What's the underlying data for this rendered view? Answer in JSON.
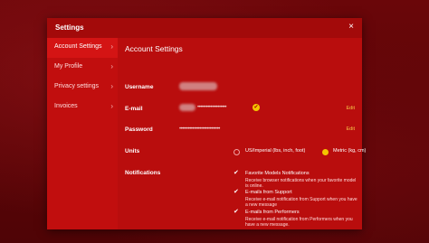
{
  "modal": {
    "title": "Settings",
    "close_label": "×"
  },
  "sidebar": {
    "items": [
      {
        "label": "Account Settings"
      },
      {
        "label": "My Profile"
      },
      {
        "label": "Privacy settings"
      },
      {
        "label": "Invoices"
      }
    ],
    "chevron": "›"
  },
  "content": {
    "title": "Account Settings",
    "username": {
      "label": "Username"
    },
    "email": {
      "label": "E-mail",
      "masked": "••••••••••••••••••••",
      "edit": "Edit"
    },
    "password": {
      "label": "Password",
      "masked": "••••••••••••••••••••••••••••",
      "edit": "Edit"
    },
    "units": {
      "label": "Units",
      "options": [
        {
          "label": "US/Imperial (lbs, inch, foot)",
          "checked": false
        },
        {
          "label": "Metric (kg, cm)",
          "checked": true
        }
      ]
    },
    "notifications": {
      "label": "Notifications",
      "items": [
        {
          "title": "Favorite Models Notifications",
          "desc": "Receive browser notifications when your favorite model is online.",
          "checked": true
        },
        {
          "title": "E-mails from Support",
          "desc": "Receive e-mail notification from Support when you have a new message",
          "checked": true
        },
        {
          "title": "E-mails from Performers",
          "desc": "Receive e-mail notification from Performers when you have a new message.",
          "checked": true
        }
      ],
      "check_glyph": "✔"
    }
  },
  "colors": {
    "modal_bg": "#b90d0d",
    "accent": "#f4c400",
    "edit_link": "#f7c948"
  }
}
